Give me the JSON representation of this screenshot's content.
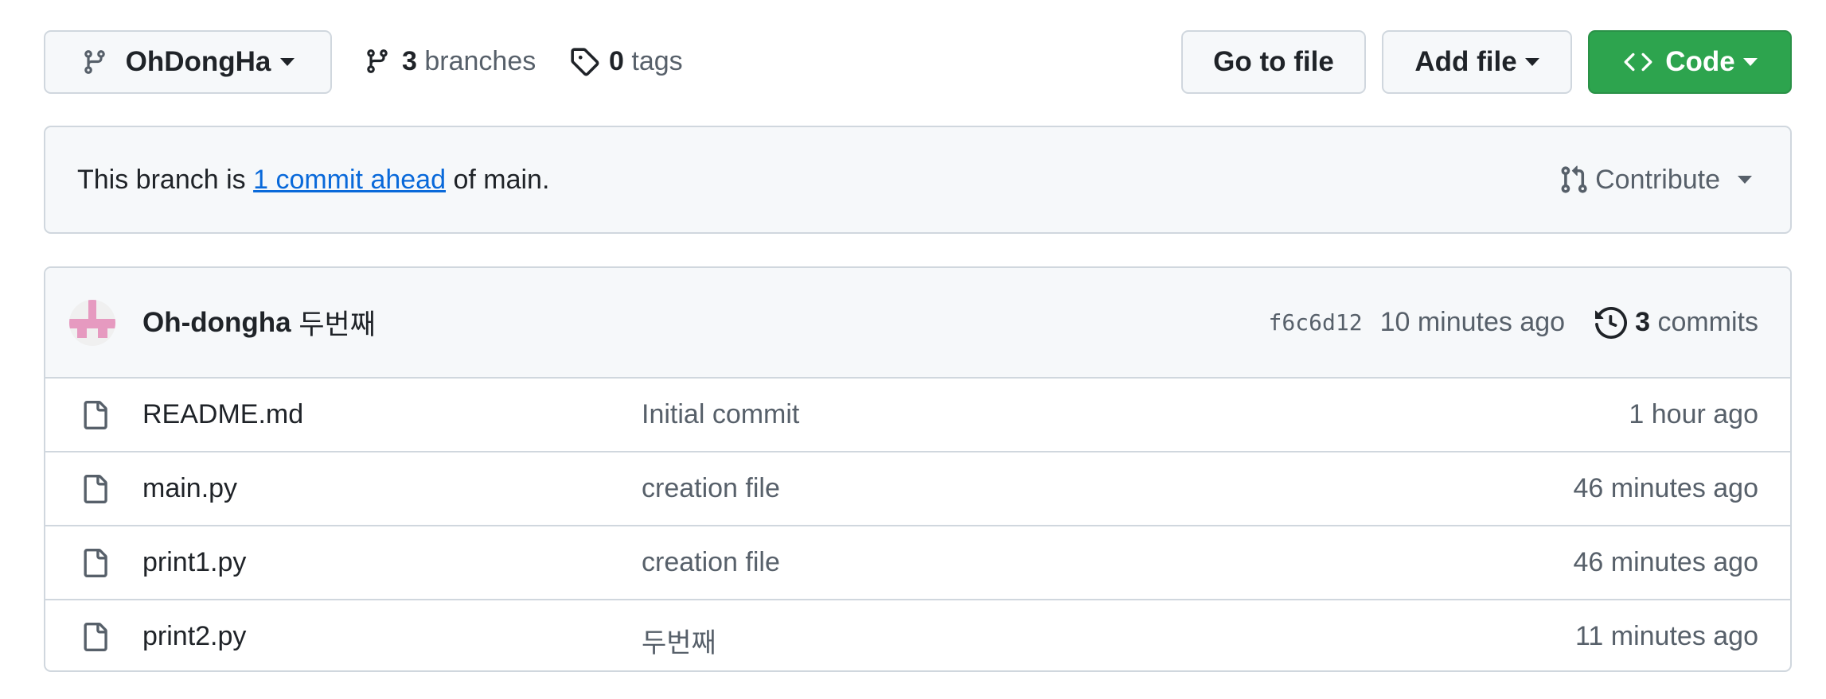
{
  "branch_button": {
    "label": "OhDongHa"
  },
  "branches": {
    "count": "3",
    "label": "branches"
  },
  "tags": {
    "count": "0",
    "label": "tags"
  },
  "actions": {
    "goto_file": "Go to file",
    "add_file": "Add file",
    "code": "Code"
  },
  "banner": {
    "prefix": "This branch is ",
    "link": "1 commit ahead",
    "suffix": " of main.",
    "contribute": "Contribute"
  },
  "commit_bar": {
    "author": "Oh-dongha",
    "message": "두번째",
    "sha": "f6c6d12",
    "time": "10 minutes ago",
    "commit_count": "3",
    "commit_label": "commits"
  },
  "files": [
    {
      "name": "README.md",
      "message": "Initial commit",
      "time": "1 hour ago"
    },
    {
      "name": "main.py",
      "message": "creation file",
      "time": "46 minutes ago"
    },
    {
      "name": "print1.py",
      "message": "creation file",
      "time": "46 minutes ago"
    },
    {
      "name": "print2.py",
      "message": "두번째",
      "time": "11 minutes ago"
    }
  ],
  "colors": {
    "primary": "#2da44e",
    "link": "#0969da",
    "border": "#d0d7de",
    "muted": "#57606a",
    "avatar": "#e69ac0"
  }
}
